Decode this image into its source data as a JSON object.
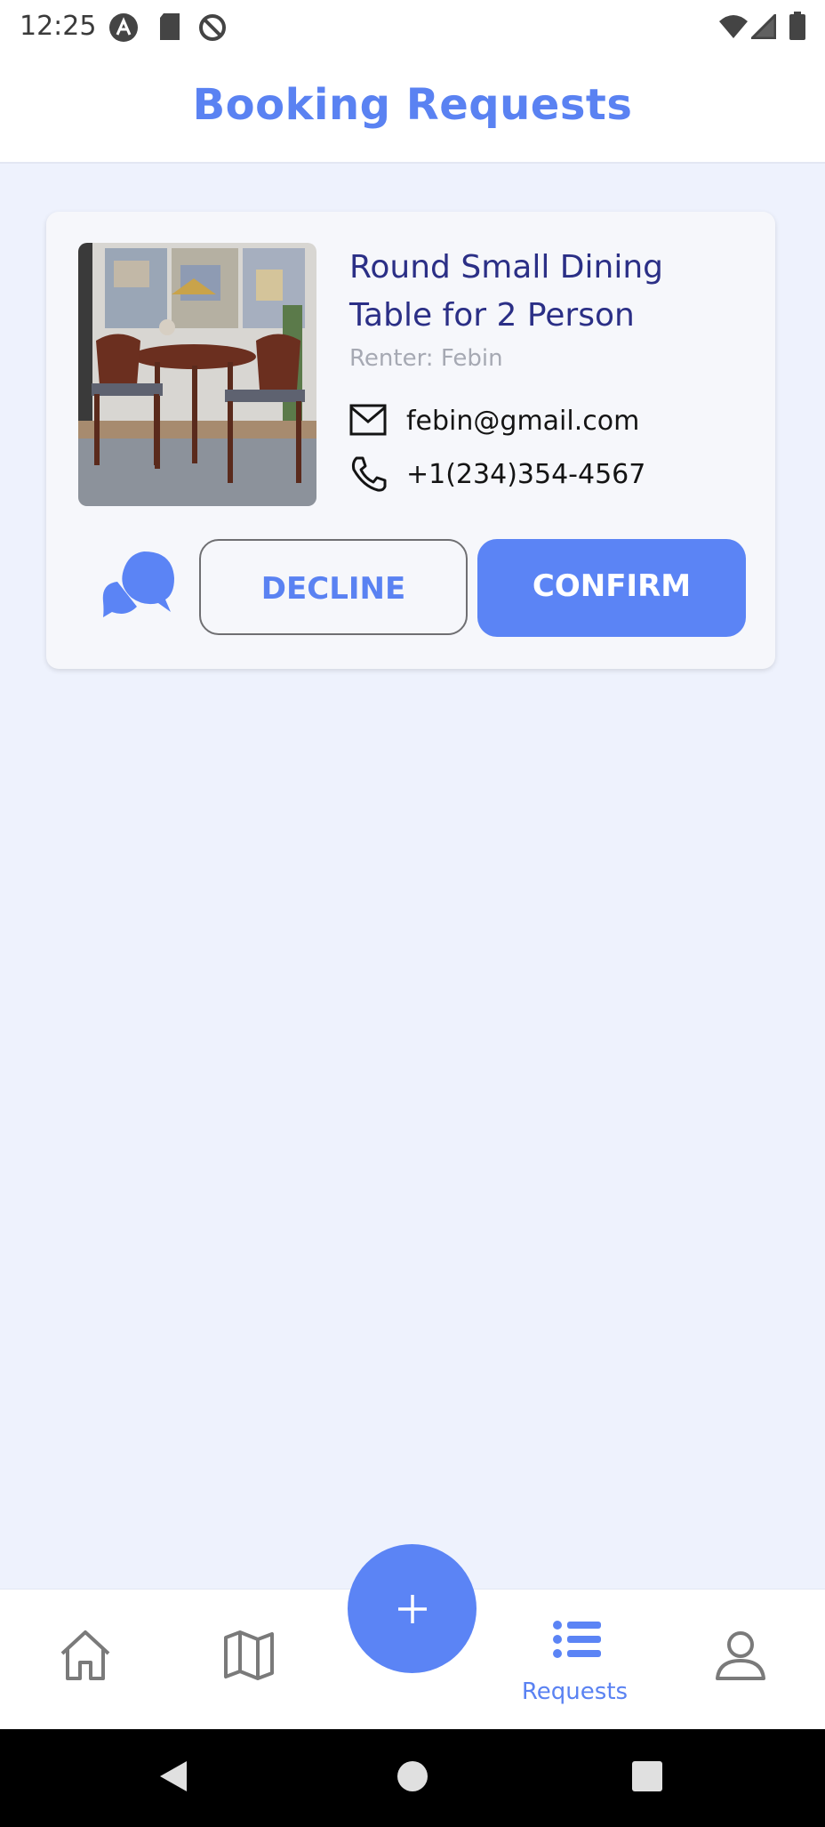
{
  "status_bar": {
    "time": "12:25",
    "left_icons": [
      "assistant-icon",
      "sd-card-icon",
      "do-not-disturb-icon"
    ],
    "right_icons": [
      "wifi-icon",
      "signal-icon",
      "battery-icon"
    ]
  },
  "header": {
    "title": "Booking Requests"
  },
  "booking": {
    "image": "dining-table-photo",
    "title": "Round Small Dining Table for 2 Person",
    "renter": "Renter: Febin",
    "email": "febin@gmail.com",
    "phone": "+1(234)354-4567",
    "chat_icon": "chat-bubbles-icon",
    "decline_label": "DECLINE",
    "confirm_label": "CONFIRM"
  },
  "bottom_nav": {
    "items": [
      {
        "icon": "home-icon",
        "label": ""
      },
      {
        "icon": "map-icon",
        "label": ""
      },
      {
        "icon": "list-icon",
        "label": "Requests",
        "active": true
      },
      {
        "icon": "profile-icon",
        "label": ""
      }
    ],
    "fab_icon": "plus-icon"
  },
  "system_nav": {
    "icons": [
      "back-icon",
      "home-circle-icon",
      "recents-icon"
    ]
  },
  "colors": {
    "accent": "#5B84F5",
    "title_text": "#2B2F86",
    "background": "#EEF2FD",
    "card": "#F6F7FB",
    "muted_text": "#A6A9B3"
  }
}
